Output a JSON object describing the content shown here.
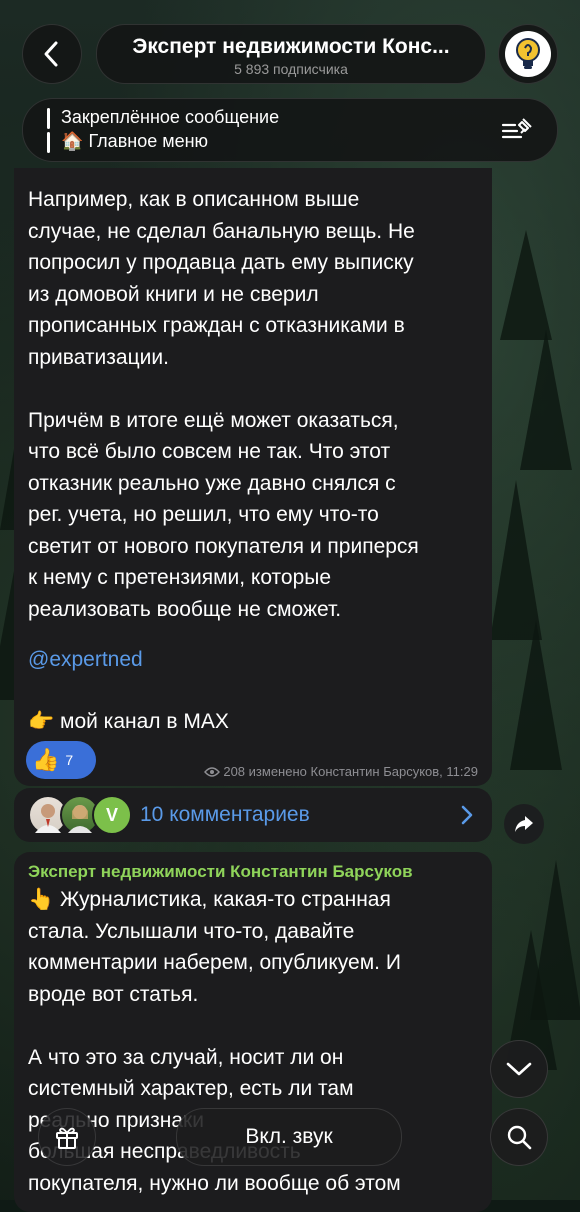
{
  "header": {
    "title": "Эксперт недвижимости Конс...",
    "subtitle": "5 893 подписчика"
  },
  "pinned": {
    "title": "Закреплённое сообщение",
    "emoji": "🏠",
    "text": "Главное меню"
  },
  "message1": {
    "lines": [
      "Например, как в описанном выше",
      "случае, не сделал банальную вещь. Не",
      "попросил у продавца дать ему выписку",
      "из домовой книги и не сверил",
      "прописанных граждан с отказниками в",
      "приватизации.",
      "",
      "Причём в итоге ещё может оказаться,",
      "что всё было совсем не так. Что этот",
      "отказник реально уже давно снялся с",
      "рег. учета, но решил, что ему что-то",
      "светит от нового покупателя и приперся",
      "к нему с претензиями, которые",
      "реализовать вообще не сможет."
    ],
    "mention": "@expertned",
    "channel_emoji": "👉",
    "channel_text": "мой канал в MAX",
    "reaction_emoji": "👍",
    "reaction_count": "7",
    "views": "208",
    "edited": "изменено",
    "author": "Константин Барсуков,",
    "time": "11:29"
  },
  "comments": {
    "label": "10 комментариев",
    "avatar_letter": "V"
  },
  "message2": {
    "author": "Эксперт недвижимости Константин Барсуков",
    "emoji": "👆",
    "lines": [
      "Журналистика, какая-то странная",
      "стала. Услышали что-то, давайте",
      "комментарии наберем, опубликуем. И",
      "вроде вот статья.",
      "",
      "А что это за случай, носит ли он",
      "системный характер, есть ли там",
      "реально признаки",
      "большая несправедливость",
      "покупателя, нужно ли вообще об этом"
    ]
  },
  "controls": {
    "sound_label": "Вкл. звук"
  },
  "colors": {
    "accent_blue": "#5a9ae8",
    "author_green": "#8fd45a",
    "reaction_bg": "#3a6fd8",
    "bubble_bg": "#1c1c1e"
  }
}
